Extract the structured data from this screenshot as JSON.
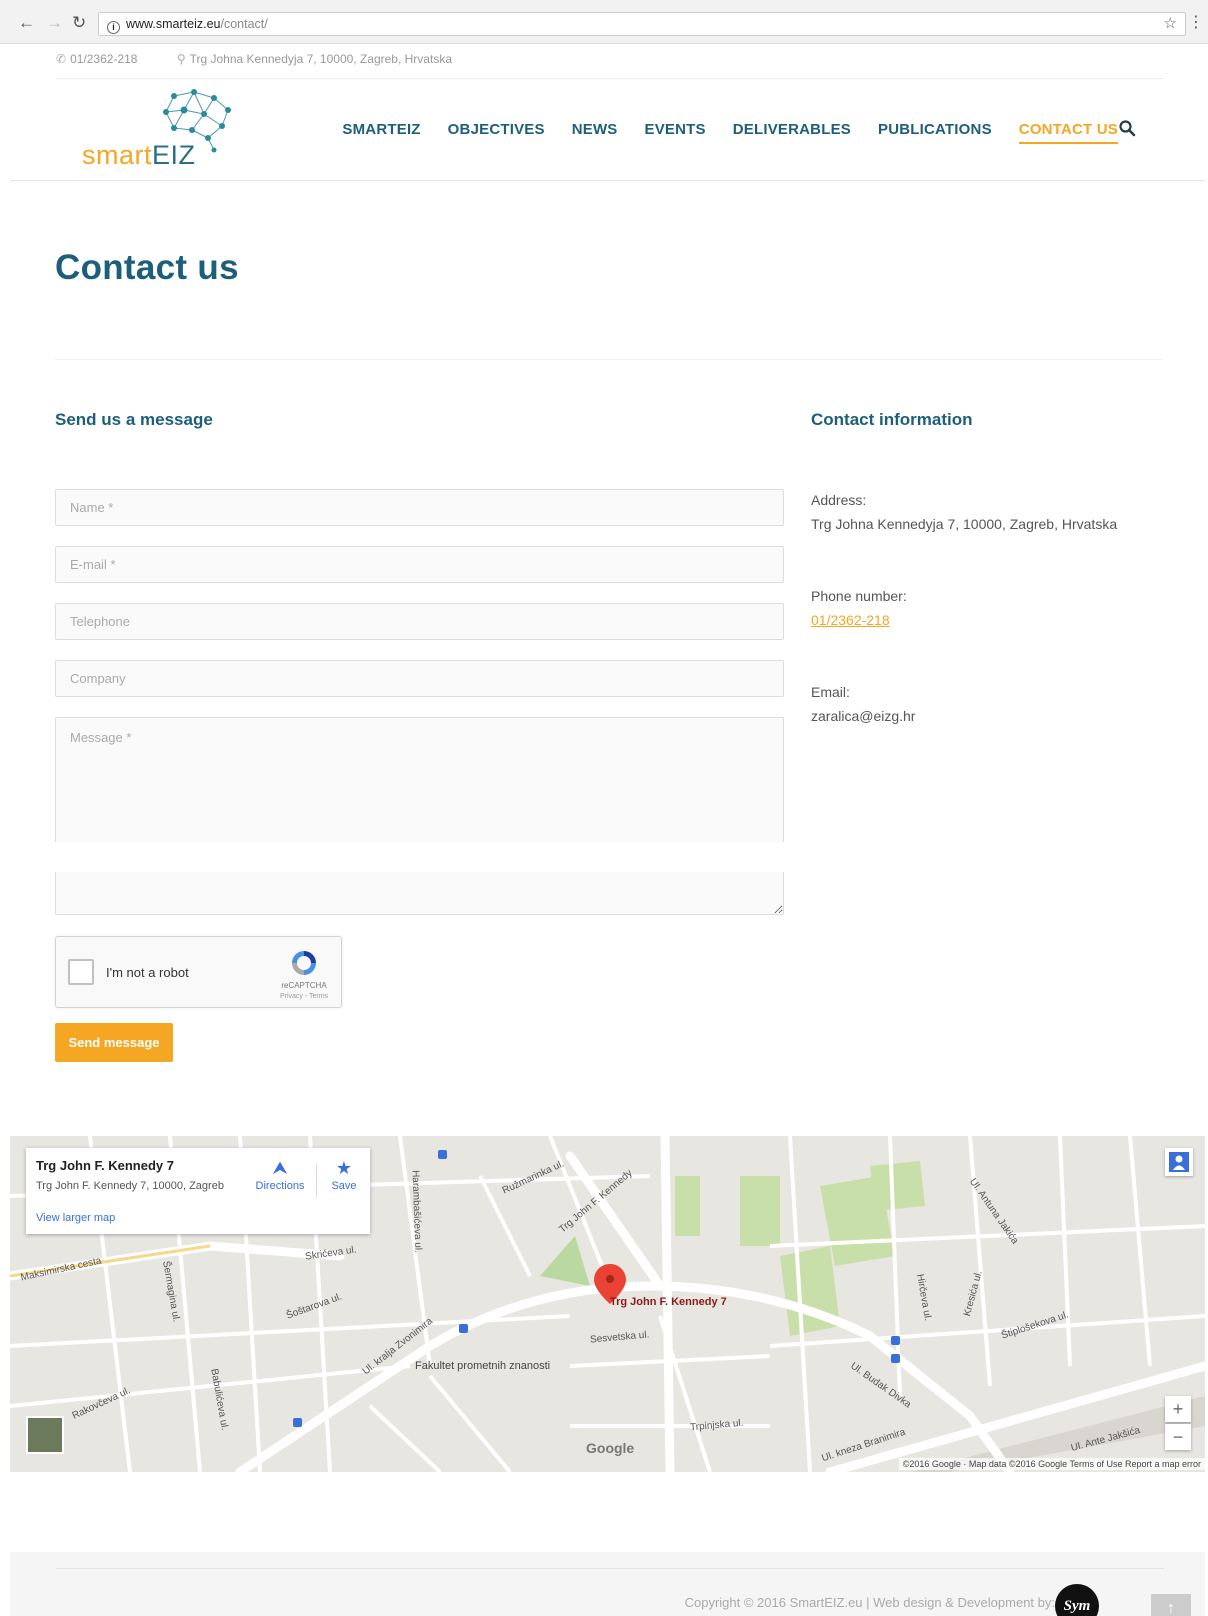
{
  "browser": {
    "url_host": "www.smarteiz.eu",
    "url_path": "/contact/"
  },
  "topbar": {
    "phone": "01/2362-218",
    "address": "Trg Johna Kennedyja 7, 10000, Zagreb, Hrvatska"
  },
  "header": {
    "logo_text_a": "smart",
    "logo_text_b": "EIZ",
    "nav": [
      "SMARTEIZ",
      "OBJECTIVES",
      "NEWS",
      "EVENTS",
      "DELIVERABLES",
      "PUBLICATIONS",
      "CONTACT US"
    ],
    "active_nav": "CONTACT US"
  },
  "page": {
    "title": "Contact us"
  },
  "form": {
    "title": "Send us a message",
    "name_placeholder": "Name *",
    "email_placeholder": "E-mail *",
    "telephone_placeholder": "Telephone",
    "company_placeholder": "Company",
    "message_placeholder": "Message *",
    "captcha_label": "I'm not a robot",
    "captcha_brand": "reCAPTCHA",
    "captcha_terms": "Privacy - Terms",
    "submit_label": "Send message"
  },
  "contact_info": {
    "title": "Contact information",
    "address_label": "Address:",
    "address_value": "Trg Johna Kennedyja 7, 10000, Zagreb, Hrvatska",
    "phone_label": "Phone number:",
    "phone_value": "01/2362-218",
    "email_label": "Email:",
    "email_value": "zaralica@eizg.hr"
  },
  "map": {
    "card_title": "Trg John F. Kennedy 7",
    "card_address": "Trg John F. Kennedy 7, 10000, Zagreb",
    "directions_label": "Directions",
    "save_label": "Save",
    "larger_map_label": "View larger map",
    "pin_label": "Trg John F. Kennedy 7",
    "zoom_in": "+",
    "zoom_out": "−",
    "google_label": "Google",
    "attribution": "©2016 Google · Map data ©2016 Google   Terms of Use   Report a map error",
    "street_labels": [
      "Ružmarinka ul.",
      "Trg John F. Kennedy",
      "Harambašićeva ul.",
      "Skrićeva ul.",
      "Šoštarova ul.",
      "Ul. kralja Zvonimira",
      "Fakultet prometnih znanosti",
      "Ul. Budak Divka",
      "Ul. kneza Branimira",
      "Štiplošekova ul.",
      "Hirčeva ul.",
      "Kresića ul.",
      "Ul. Antuna Jakića",
      "Rakovčeva ul.",
      "Maksimirska cesta",
      "Šermagina ul.",
      "Babulićeva ul.",
      "Trpinjska ul.",
      "Ul. Ante Jakšića",
      "Sesvetska ul."
    ]
  },
  "footer": {
    "copyright": "Copyright © 2016 SmartEIZ.eu | Web design & Development by:",
    "badge": "Sym",
    "top_arrow": "↑"
  },
  "colors": {
    "primary": "#1d5f7a",
    "accent": "#f5a623"
  }
}
